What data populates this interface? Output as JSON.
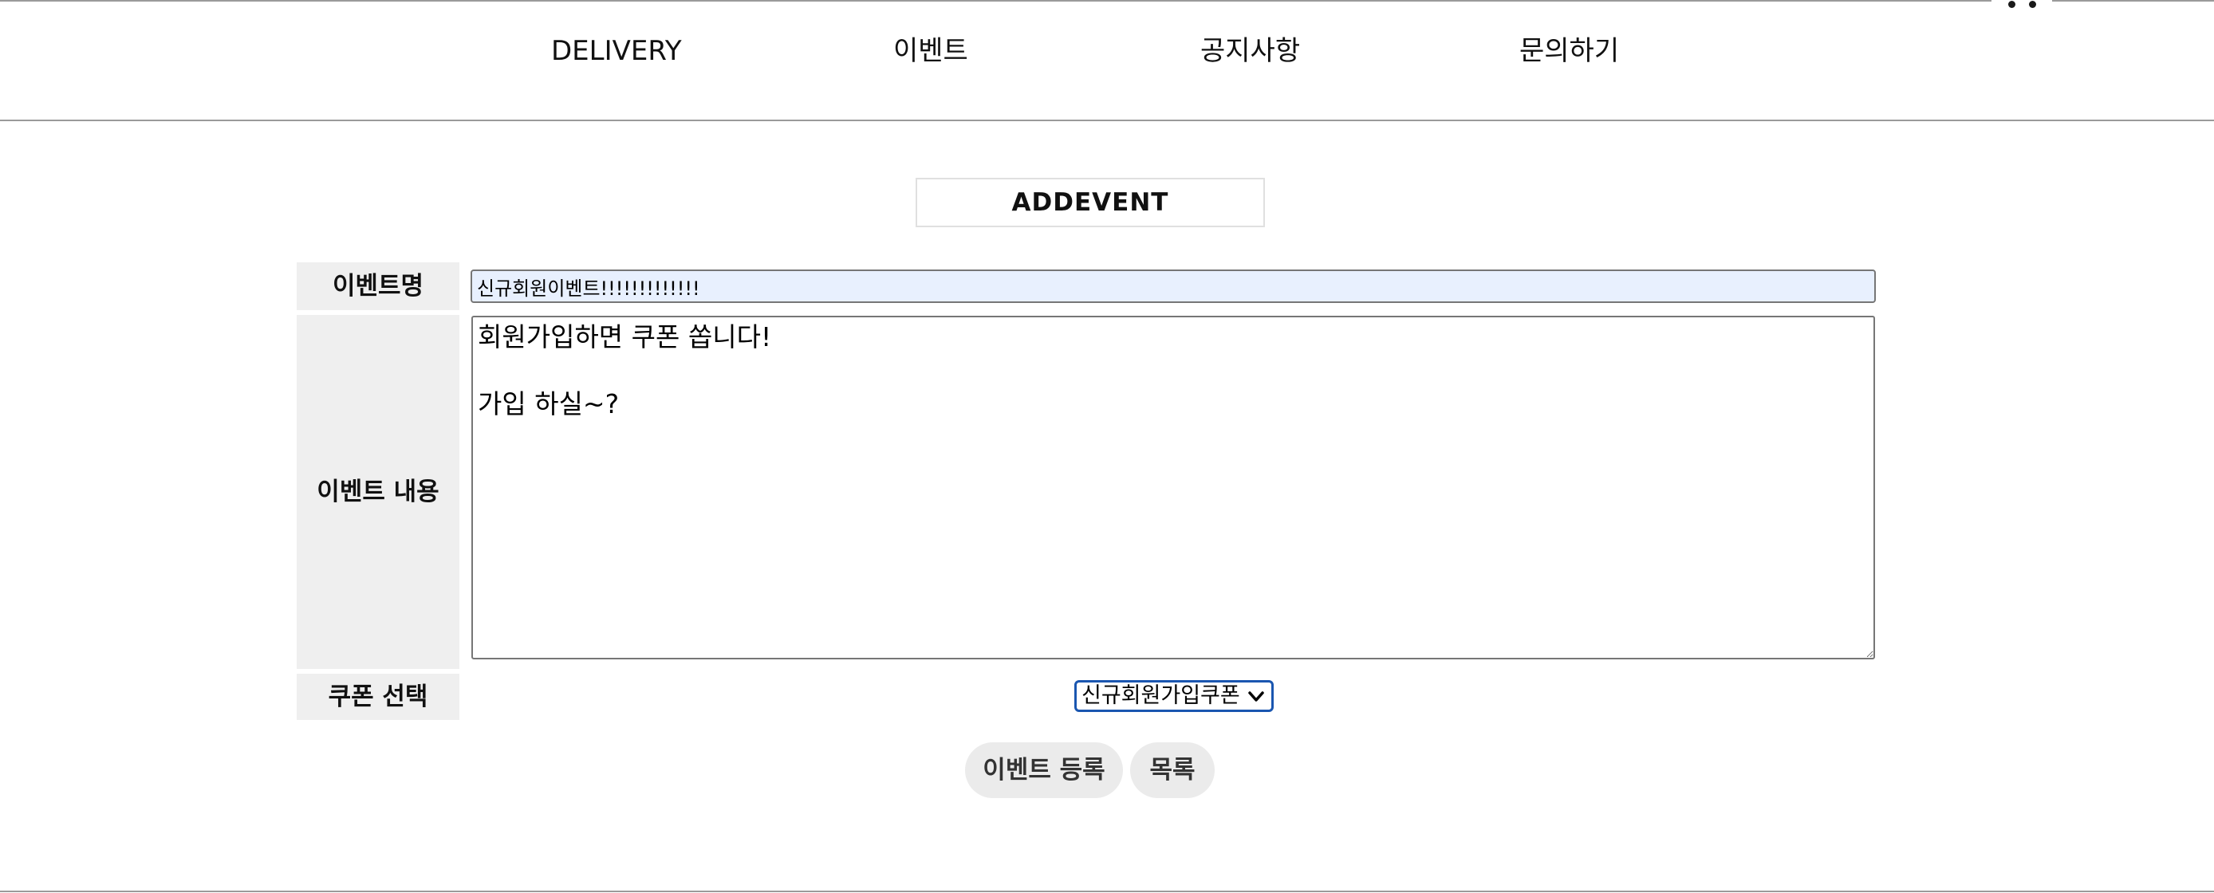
{
  "nav": {
    "items": [
      {
        "label": "DELIVERY"
      },
      {
        "label": "이벤트"
      },
      {
        "label": "공지사항"
      },
      {
        "label": "문의하기"
      }
    ]
  },
  "form": {
    "title": "ADDEVENT",
    "name_label": "이벤트명",
    "name_value": "신규회원이벤트!!!!!!!!!!!!!",
    "content_label": "이벤트 내용",
    "content_value": "회원가입하면 쿠폰 쏩니다!\n\n가입 하실~?",
    "coupon_label": "쿠폰 선택",
    "coupon_selected": "신규회원가입쿠폰"
  },
  "actions": {
    "submit_label": "이벤트 등록",
    "list_label": "목록"
  }
}
